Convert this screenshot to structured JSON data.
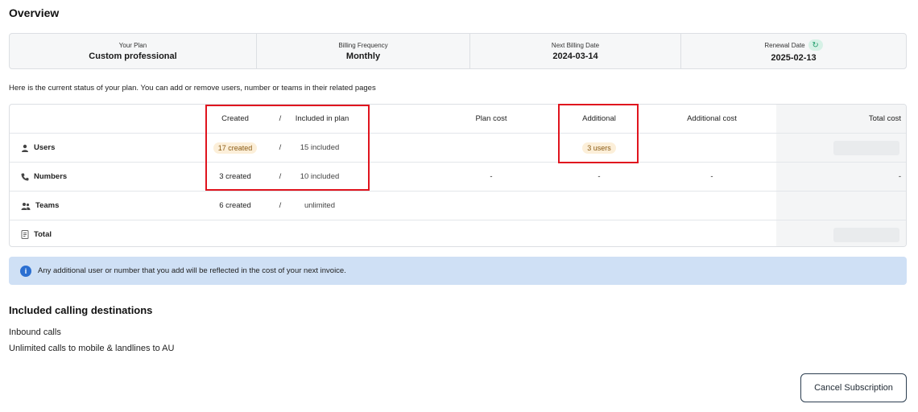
{
  "page": {
    "title": "Overview"
  },
  "summary": {
    "plan_label": "Your Plan",
    "plan_value": "Custom professional",
    "billing_label": "Billing Frequency",
    "billing_value": "Monthly",
    "next_label": "Next Billing Date",
    "next_value": "2024-03-14",
    "renewal_label": "Renewal Date",
    "renewal_value": "2025-02-13",
    "renewal_icon": "refresh-icon"
  },
  "status_text": "Here is the current status of your plan. You can add or remove users, number or teams in their related pages",
  "table": {
    "headers": {
      "created": "Created",
      "slash": "/",
      "included": "Included in plan",
      "plan_cost": "Plan cost",
      "additional": "Additional",
      "additional_cost": "Additional cost",
      "total_cost": "Total cost"
    },
    "rows": [
      {
        "label": "Users",
        "icon": "user-icon",
        "created": "17 created",
        "included": "15 included",
        "plan_cost": "",
        "additional": "3 users",
        "additional_cost": "",
        "total": ""
      },
      {
        "label": "Numbers",
        "icon": "phone-icon",
        "created": "3 created",
        "included": "10 included",
        "plan_cost": "-",
        "additional": "-",
        "additional_cost": "-",
        "total": "-"
      },
      {
        "label": "Teams",
        "icon": "team-icon",
        "created": "6 created",
        "included": "unlimited",
        "plan_cost": "",
        "additional": "",
        "additional_cost": "",
        "total": ""
      },
      {
        "label": "Total",
        "icon": "receipt-icon"
      }
    ]
  },
  "info": {
    "text": "Any additional user or number that you add will be reflected in the cost of your next invoice.",
    "icon": "info-icon"
  },
  "destinations": {
    "title": "Included calling destinations",
    "items": [
      "Inbound calls",
      "Unlimited calls to mobile & landlines to AU"
    ]
  },
  "cancel_button": "Cancel Subscription",
  "colors": {
    "highlight_box": "#e0141e",
    "info_bg": "#cfe0f5",
    "chip_bg": "#fcefd9"
  }
}
